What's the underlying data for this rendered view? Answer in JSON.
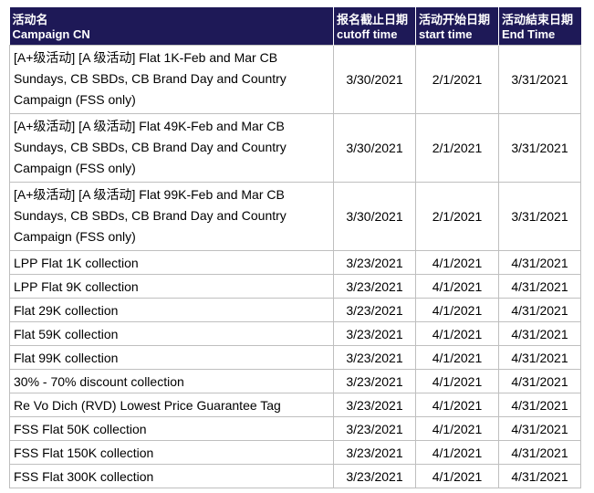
{
  "headers": [
    {
      "cn": "活动名",
      "en": "Campaign CN"
    },
    {
      "cn": "报名截止日期",
      "en": "cutoff time"
    },
    {
      "cn": "活动开始日期",
      "en": "start time"
    },
    {
      "cn": "活动結束日期",
      "en": "End Time"
    }
  ],
  "rows": [
    {
      "name": "[A+级活动] [A 级活动] Flat 1K-Feb and Mar CB Sundays, CB SBDs, CB Brand Day and Country Campaign (FSS only)",
      "cutoff": "3/30/2021",
      "start": "2/1/2021",
      "end": "3/31/2021"
    },
    {
      "name": "[A+级活动] [A 级活动] Flat 49K-Feb and Mar CB Sundays, CB SBDs, CB Brand Day and Country Campaign (FSS only)",
      "cutoff": "3/30/2021",
      "start": "2/1/2021",
      "end": "3/31/2021"
    },
    {
      "name": "[A+级活动] [A 级活动] Flat 99K-Feb and Mar CB Sundays, CB SBDs, CB Brand Day and Country Campaign (FSS only)",
      "cutoff": "3/30/2021",
      "start": "2/1/2021",
      "end": "3/31/2021"
    },
    {
      "name": "LPP Flat 1K collection",
      "cutoff": "3/23/2021",
      "start": "4/1/2021",
      "end": "4/31/2021"
    },
    {
      "name": "LPP Flat 9K collection",
      "cutoff": "3/23/2021",
      "start": "4/1/2021",
      "end": "4/31/2021"
    },
    {
      "name": "Flat 29K collection",
      "cutoff": "3/23/2021",
      "start": "4/1/2021",
      "end": "4/31/2021"
    },
    {
      "name": "Flat 59K collection",
      "cutoff": "3/23/2021",
      "start": "4/1/2021",
      "end": "4/31/2021"
    },
    {
      "name": "Flat 99K collection",
      "cutoff": "3/23/2021",
      "start": "4/1/2021",
      "end": "4/31/2021"
    },
    {
      "name": "30% - 70% discount collection",
      "cutoff": "3/23/2021",
      "start": "4/1/2021",
      "end": "4/31/2021"
    },
    {
      "name": "Re Vo Dich (RVD) Lowest Price Guarantee Tag",
      "cutoff": "3/23/2021",
      "start": "4/1/2021",
      "end": "4/31/2021"
    },
    {
      "name": "FSS Flat 50K collection",
      "cutoff": "3/23/2021",
      "start": "4/1/2021",
      "end": "4/31/2021"
    },
    {
      "name": "FSS Flat 150K collection",
      "cutoff": "3/23/2021",
      "start": "4/1/2021",
      "end": "4/31/2021"
    },
    {
      "name": "FSS Flat 300K collection",
      "cutoff": "3/23/2021",
      "start": "4/1/2021",
      "end": "4/31/2021"
    }
  ],
  "colors": {
    "header_bg": "#1e1957",
    "header_text": "#ffffff",
    "border": "#bfbfbf"
  }
}
